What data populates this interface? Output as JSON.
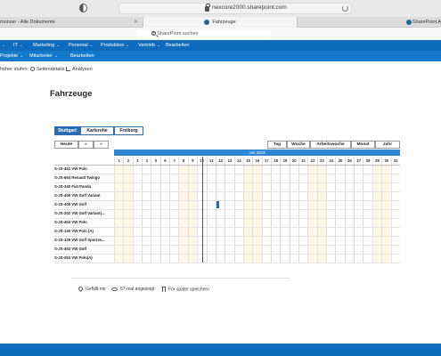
{
  "browser": {
    "url": "nexcore2000.sharepoint.com",
    "tabs": [
      {
        "label": "monzer - Alle Dokumente"
      },
      {
        "label": "Fahrzeuge"
      },
      {
        "label": "SharePoint A"
      }
    ]
  },
  "search": {
    "placeholder": "In SharePoint suchen"
  },
  "topnav": {
    "items": [
      {
        "label": "",
        "chev": "⌄"
      },
      {
        "label": "IT",
        "chev": "⌄"
      },
      {
        "label": "Marketing",
        "chev": "⌄"
      },
      {
        "label": "Personal",
        "chev": "⌄"
      },
      {
        "label": "Produktion",
        "chev": "⌄"
      },
      {
        "label": "Vertrieb",
        "chev": "⌄"
      },
      {
        "label": "Bearbeiten",
        "chev": ""
      }
    ]
  },
  "subnav": {
    "items": [
      {
        "label": "Projekte",
        "chev": "⌄"
      },
      {
        "label": "Mitarbeiter",
        "chev": "⌄"
      },
      {
        "label": "Bearbeiten",
        "chev": ""
      }
    ]
  },
  "commandbar": {
    "items": [
      {
        "label": "höher stufen",
        "icon": ""
      },
      {
        "label": "Seitendetails",
        "icon": "gear-icon"
      },
      {
        "label": "Analysen",
        "icon": "chart-icon"
      }
    ]
  },
  "page": {
    "title": "Fahrzeuge"
  },
  "locations": [
    {
      "label": "Stuttgart",
      "active": true
    },
    {
      "label": "Karlsruhe",
      "active": false
    },
    {
      "label": "Freiburg",
      "active": false
    }
  ],
  "controls": {
    "today": "Heute",
    "prev": "«",
    "next": "»",
    "views": [
      "Tag",
      "Woche",
      "Arbeitswoche",
      "Monat",
      "Jahr"
    ]
  },
  "calendar": {
    "month": "Juli 2023",
    "days": [
      "1",
      "2",
      "3",
      "4",
      "5",
      "6",
      "7",
      "8",
      "9",
      "10",
      "11",
      "12",
      "13",
      "14",
      "15",
      "16",
      "17",
      "18",
      "19",
      "20",
      "21",
      "22",
      "23",
      "24",
      "25",
      "26",
      "27",
      "28",
      "29",
      "30",
      "31"
    ],
    "weekend_days": [
      "1",
      "2",
      "8",
      "9",
      "15",
      "16",
      "22",
      "23",
      "29",
      "30"
    ],
    "vehicles": [
      "S-JS-451 VW Polo",
      "S-JS-654 Renault Twingo",
      "S-JS-340 Fiat Panda",
      "S-JS-406 VW Golf Variant",
      "S-JS-405 VW Golf",
      "S-JS-202 VW Golf Variant(...",
      "S-JS-404 VW Polo",
      "S-JS-140 VW Polo (A)",
      "S-JS-125 VW Golf Sportsv...",
      "S-JS-453 VW Golf",
      "S-JS-253 VW Polo(A)"
    ],
    "booking": {
      "vehicle": "S-JS-405 VW Golf",
      "day": "12"
    }
  },
  "footer": {
    "like": "Gefällt mir",
    "views": "57-mal angezeigt",
    "save": "Für später speichern"
  },
  "colors": {
    "brand": "#0f6cbd",
    "accent": "#2b6cb0",
    "weekend": "#fdf8e6"
  }
}
